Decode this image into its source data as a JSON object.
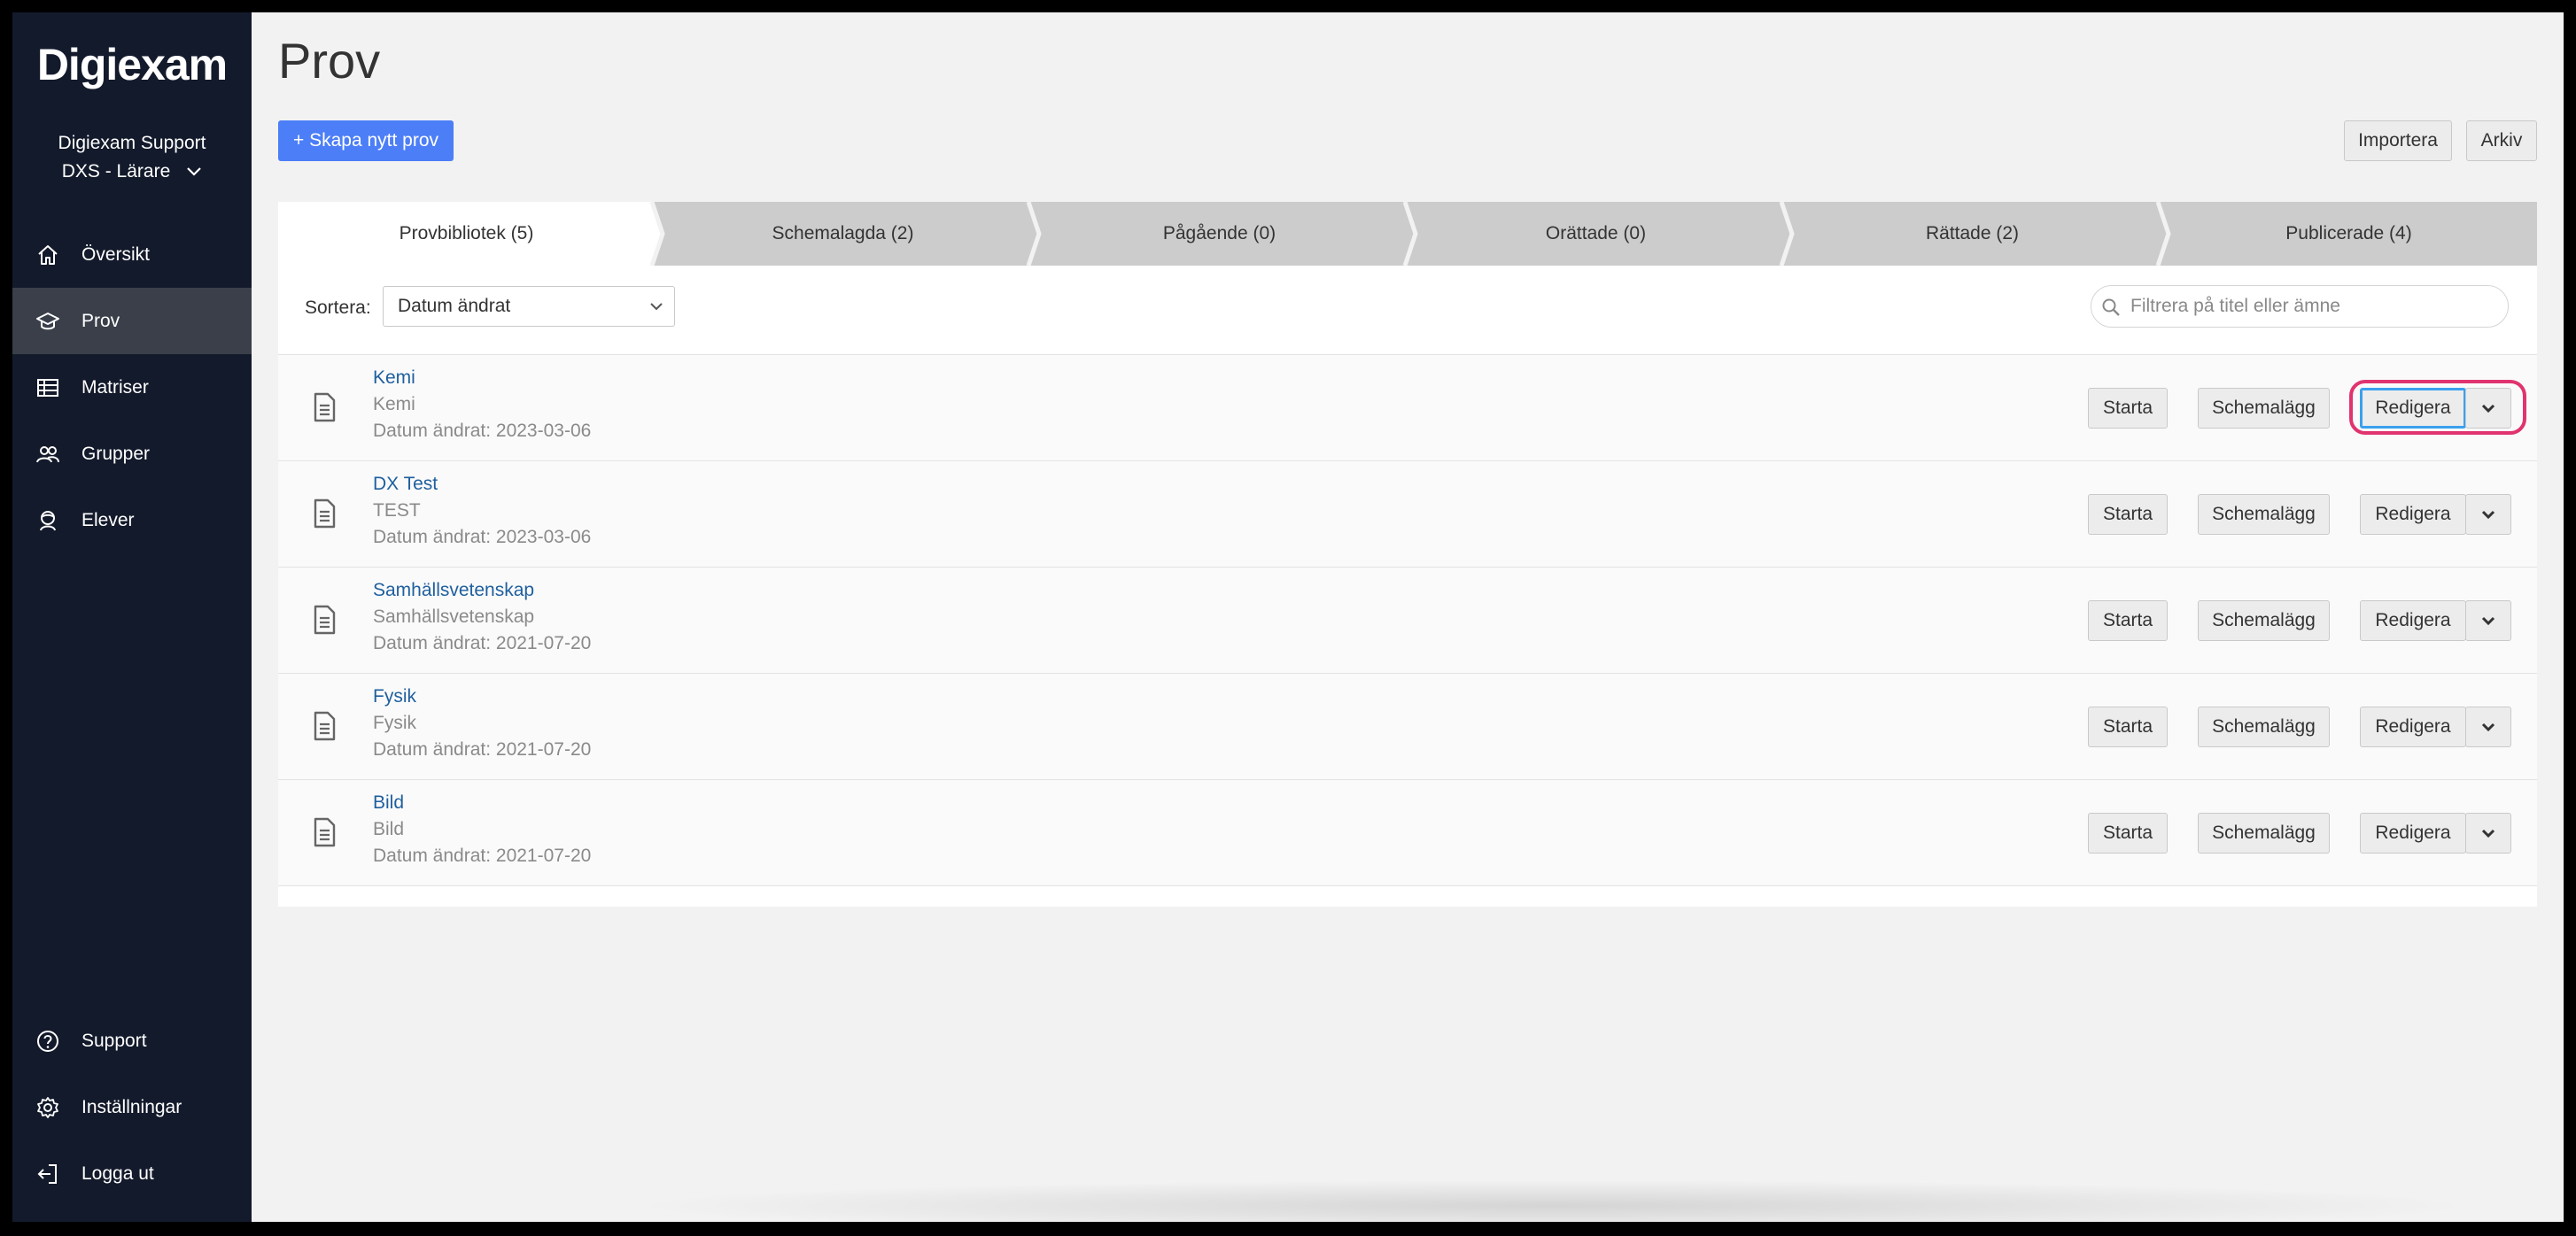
{
  "app": {
    "logo": "Digiexam"
  },
  "user": {
    "name": "Digiexam Support",
    "role": "DXS - Lärare"
  },
  "nav": {
    "items": [
      {
        "label": "Översikt",
        "icon": "home-icon",
        "active": false
      },
      {
        "label": "Prov",
        "icon": "graduation-cap-icon",
        "active": true
      },
      {
        "label": "Matriser",
        "icon": "grid-icon",
        "active": false
      },
      {
        "label": "Grupper",
        "icon": "users-icon",
        "active": false
      },
      {
        "label": "Elever",
        "icon": "student-icon",
        "active": false
      }
    ],
    "bottom": [
      {
        "label": "Support",
        "icon": "help-circle-icon"
      },
      {
        "label": "Inställningar",
        "icon": "gear-icon"
      },
      {
        "label": "Logga ut",
        "icon": "logout-icon"
      }
    ]
  },
  "page": {
    "title": "Prov",
    "new_test": "+ Skapa nytt prov",
    "import": "Importera",
    "archive": "Arkiv"
  },
  "tabs": [
    {
      "label": "Provbibliotek (5)",
      "active": true
    },
    {
      "label": "Schemalagda (2)",
      "active": false
    },
    {
      "label": "Pågående (0)",
      "active": false
    },
    {
      "label": "Orättade (0)",
      "active": false
    },
    {
      "label": "Rättade (2)",
      "active": false
    },
    {
      "label": "Publicerade (4)",
      "active": false
    }
  ],
  "sort": {
    "label": "Sortera:",
    "value": "Datum ändrat"
  },
  "filter": {
    "placeholder": "Filtrera på titel eller ämne"
  },
  "actions": {
    "start": "Starta",
    "schedule": "Schemalägg",
    "edit": "Redigera"
  },
  "tests": [
    {
      "title": "Kemi",
      "subject": "Kemi",
      "date": "Datum ändrat: 2023-03-06",
      "highlighted": true
    },
    {
      "title": "DX Test",
      "subject": "TEST",
      "date": "Datum ändrat: 2023-03-06"
    },
    {
      "title": "Samhällsvetenskap",
      "subject": "Samhällsvetenskap",
      "date": "Datum ändrat: 2021-07-20"
    },
    {
      "title": "Fysik",
      "subject": "Fysik",
      "date": "Datum ändrat: 2021-07-20"
    },
    {
      "title": "Bild",
      "subject": "Bild",
      "date": "Datum ändrat: 2021-07-20"
    }
  ],
  "colors": {
    "sidebar": "#131a2b",
    "primary": "#4c7ef7",
    "link": "#1f5f9e",
    "highlight": "#e0336f"
  }
}
